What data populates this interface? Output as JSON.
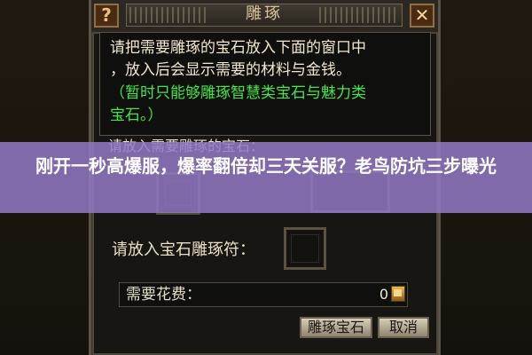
{
  "window": {
    "title": "雕琢",
    "help_label": "?",
    "close_label": "✕"
  },
  "description": {
    "line1": "请把需要雕琢的宝石放入下面的窗口中",
    "line2": "，放入后会显示需要的材料与金钱。",
    "line3": "（暂时只能够雕琢智慧类宝石与魅力类",
    "line4": "宝石。）"
  },
  "gem_area": {
    "label": "请放入需要雕琢的宝石："
  },
  "symbol": {
    "label": "请放入宝石雕琢符："
  },
  "cost": {
    "label": "需要花费：",
    "value": "0",
    "icon": "gold-coin-icon"
  },
  "buttons": {
    "carve": "雕琢宝石",
    "cancel": "取消"
  },
  "overlay": {
    "headline": "刚开一秒高爆服，爆率翻倍却三天关服？老鸟防坑三步曝光"
  },
  "colors": {
    "normal_text": "#f2e6d0",
    "highlight_text": "#47e44b",
    "overlay_bg": "#9379c4"
  }
}
